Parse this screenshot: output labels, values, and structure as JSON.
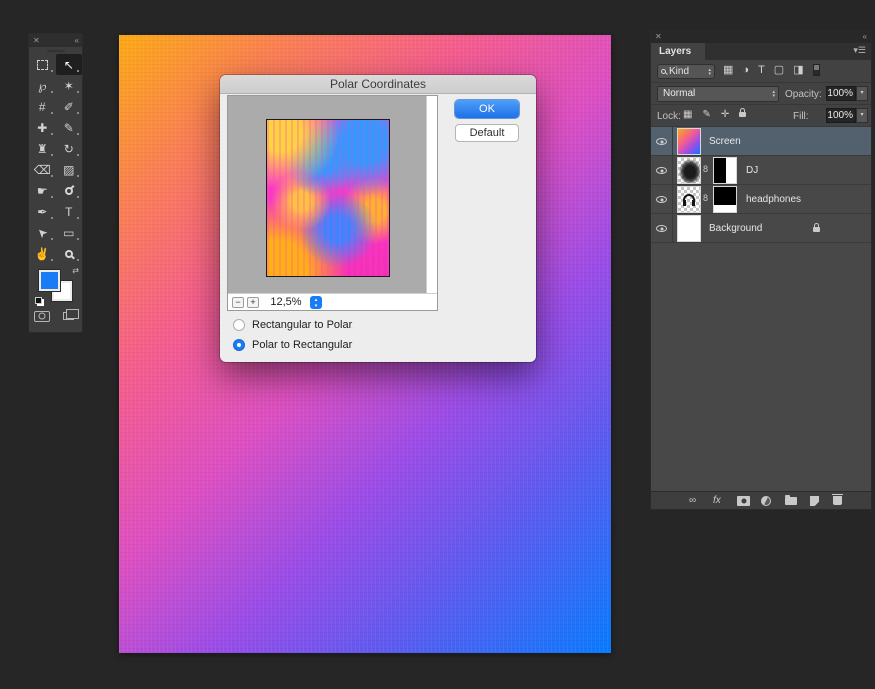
{
  "dialog": {
    "title": "Polar Coordinates",
    "zoom_value": "12,5%",
    "minus": "−",
    "plus": "+",
    "ok_label": "OK",
    "default_label": "Default",
    "radio_rect_to_polar": "Rectangular to Polar",
    "radio_polar_to_rect": "Polar to Rectangular",
    "selected_option": "Polar to Rectangular"
  },
  "layers_panel": {
    "tab": "Layers",
    "kind": "Kind",
    "blend_mode": "Normal",
    "opacity_label": "Opacity:",
    "opacity_value": "100%",
    "lock_label": "Lock:",
    "fill_label": "Fill:",
    "fill_value": "100%",
    "layers": [
      {
        "name": "Screen",
        "selected": true
      },
      {
        "name": "DJ",
        "linked": true
      },
      {
        "name": "headphones",
        "linked": true
      },
      {
        "name": "Background",
        "locked": true
      }
    ]
  },
  "icons": {
    "close": "✕",
    "collapse": "«",
    "move": "↖",
    "lasso": "℘",
    "wand": "✶",
    "crop": "#",
    "eyedropper": "✐",
    "healing": "✚",
    "brush": "✎",
    "stamp": "♜",
    "history_brush": "↻",
    "eraser": "⌫",
    "bucket": "▨",
    "smudge": "☛",
    "pen": "✒",
    "type": "T",
    "path_select": "➤",
    "shape": "▭",
    "hand": "✌",
    "swap": "⇄",
    "panel_menu": "☰",
    "caret_up": "▴",
    "caret_down": "▾",
    "pixel_filter": "▦",
    "adjust_filter": "◑",
    "type_filter": "T",
    "shape_filter": "▢",
    "smart_filter": "◨",
    "lock_transparent": "▦",
    "lock_paint": "✎",
    "lock_move": "✛",
    "link": "∞",
    "fx": "fx",
    "chain": "8"
  },
  "colors": {
    "accent_blue": "#1a7cf5",
    "canvas_orange": "#fcaa13",
    "canvas_pink": "#f55c8f",
    "canvas_purple": "#9a4ce8",
    "canvas_blue": "#087bff",
    "selected_layer_row": "#53616e",
    "foreground_swatch": "#1a7cf5"
  }
}
